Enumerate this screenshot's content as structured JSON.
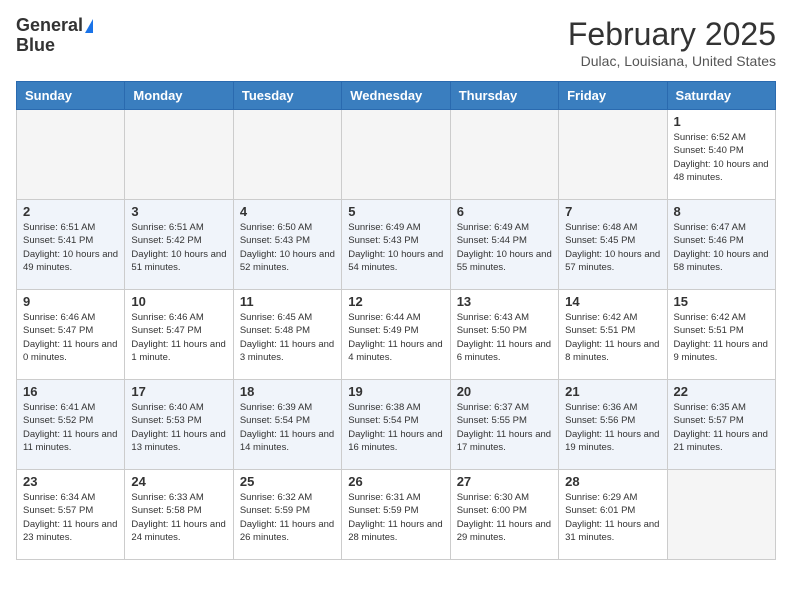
{
  "header": {
    "logo_line1": "General",
    "logo_line2": "Blue",
    "title": "February 2025",
    "subtitle": "Dulac, Louisiana, United States"
  },
  "calendar": {
    "days_of_week": [
      "Sunday",
      "Monday",
      "Tuesday",
      "Wednesday",
      "Thursday",
      "Friday",
      "Saturday"
    ],
    "weeks": [
      {
        "alt": false,
        "days": [
          {
            "num": "",
            "info": "",
            "empty": true
          },
          {
            "num": "",
            "info": "",
            "empty": true
          },
          {
            "num": "",
            "info": "",
            "empty": true
          },
          {
            "num": "",
            "info": "",
            "empty": true
          },
          {
            "num": "",
            "info": "",
            "empty": true
          },
          {
            "num": "",
            "info": "",
            "empty": true
          },
          {
            "num": "1",
            "info": "Sunrise: 6:52 AM\nSunset: 5:40 PM\nDaylight: 10 hours and 48 minutes.",
            "empty": false
          }
        ]
      },
      {
        "alt": true,
        "days": [
          {
            "num": "2",
            "info": "Sunrise: 6:51 AM\nSunset: 5:41 PM\nDaylight: 10 hours and 49 minutes.",
            "empty": false
          },
          {
            "num": "3",
            "info": "Sunrise: 6:51 AM\nSunset: 5:42 PM\nDaylight: 10 hours and 51 minutes.",
            "empty": false
          },
          {
            "num": "4",
            "info": "Sunrise: 6:50 AM\nSunset: 5:43 PM\nDaylight: 10 hours and 52 minutes.",
            "empty": false
          },
          {
            "num": "5",
            "info": "Sunrise: 6:49 AM\nSunset: 5:43 PM\nDaylight: 10 hours and 54 minutes.",
            "empty": false
          },
          {
            "num": "6",
            "info": "Sunrise: 6:49 AM\nSunset: 5:44 PM\nDaylight: 10 hours and 55 minutes.",
            "empty": false
          },
          {
            "num": "7",
            "info": "Sunrise: 6:48 AM\nSunset: 5:45 PM\nDaylight: 10 hours and 57 minutes.",
            "empty": false
          },
          {
            "num": "8",
            "info": "Sunrise: 6:47 AM\nSunset: 5:46 PM\nDaylight: 10 hours and 58 minutes.",
            "empty": false
          }
        ]
      },
      {
        "alt": false,
        "days": [
          {
            "num": "9",
            "info": "Sunrise: 6:46 AM\nSunset: 5:47 PM\nDaylight: 11 hours and 0 minutes.",
            "empty": false
          },
          {
            "num": "10",
            "info": "Sunrise: 6:46 AM\nSunset: 5:47 PM\nDaylight: 11 hours and 1 minute.",
            "empty": false
          },
          {
            "num": "11",
            "info": "Sunrise: 6:45 AM\nSunset: 5:48 PM\nDaylight: 11 hours and 3 minutes.",
            "empty": false
          },
          {
            "num": "12",
            "info": "Sunrise: 6:44 AM\nSunset: 5:49 PM\nDaylight: 11 hours and 4 minutes.",
            "empty": false
          },
          {
            "num": "13",
            "info": "Sunrise: 6:43 AM\nSunset: 5:50 PM\nDaylight: 11 hours and 6 minutes.",
            "empty": false
          },
          {
            "num": "14",
            "info": "Sunrise: 6:42 AM\nSunset: 5:51 PM\nDaylight: 11 hours and 8 minutes.",
            "empty": false
          },
          {
            "num": "15",
            "info": "Sunrise: 6:42 AM\nSunset: 5:51 PM\nDaylight: 11 hours and 9 minutes.",
            "empty": false
          }
        ]
      },
      {
        "alt": true,
        "days": [
          {
            "num": "16",
            "info": "Sunrise: 6:41 AM\nSunset: 5:52 PM\nDaylight: 11 hours and 11 minutes.",
            "empty": false
          },
          {
            "num": "17",
            "info": "Sunrise: 6:40 AM\nSunset: 5:53 PM\nDaylight: 11 hours and 13 minutes.",
            "empty": false
          },
          {
            "num": "18",
            "info": "Sunrise: 6:39 AM\nSunset: 5:54 PM\nDaylight: 11 hours and 14 minutes.",
            "empty": false
          },
          {
            "num": "19",
            "info": "Sunrise: 6:38 AM\nSunset: 5:54 PM\nDaylight: 11 hours and 16 minutes.",
            "empty": false
          },
          {
            "num": "20",
            "info": "Sunrise: 6:37 AM\nSunset: 5:55 PM\nDaylight: 11 hours and 17 minutes.",
            "empty": false
          },
          {
            "num": "21",
            "info": "Sunrise: 6:36 AM\nSunset: 5:56 PM\nDaylight: 11 hours and 19 minutes.",
            "empty": false
          },
          {
            "num": "22",
            "info": "Sunrise: 6:35 AM\nSunset: 5:57 PM\nDaylight: 11 hours and 21 minutes.",
            "empty": false
          }
        ]
      },
      {
        "alt": false,
        "days": [
          {
            "num": "23",
            "info": "Sunrise: 6:34 AM\nSunset: 5:57 PM\nDaylight: 11 hours and 23 minutes.",
            "empty": false
          },
          {
            "num": "24",
            "info": "Sunrise: 6:33 AM\nSunset: 5:58 PM\nDaylight: 11 hours and 24 minutes.",
            "empty": false
          },
          {
            "num": "25",
            "info": "Sunrise: 6:32 AM\nSunset: 5:59 PM\nDaylight: 11 hours and 26 minutes.",
            "empty": false
          },
          {
            "num": "26",
            "info": "Sunrise: 6:31 AM\nSunset: 5:59 PM\nDaylight: 11 hours and 28 minutes.",
            "empty": false
          },
          {
            "num": "27",
            "info": "Sunrise: 6:30 AM\nSunset: 6:00 PM\nDaylight: 11 hours and 29 minutes.",
            "empty": false
          },
          {
            "num": "28",
            "info": "Sunrise: 6:29 AM\nSunset: 6:01 PM\nDaylight: 11 hours and 31 minutes.",
            "empty": false
          },
          {
            "num": "",
            "info": "",
            "empty": true
          }
        ]
      }
    ]
  }
}
